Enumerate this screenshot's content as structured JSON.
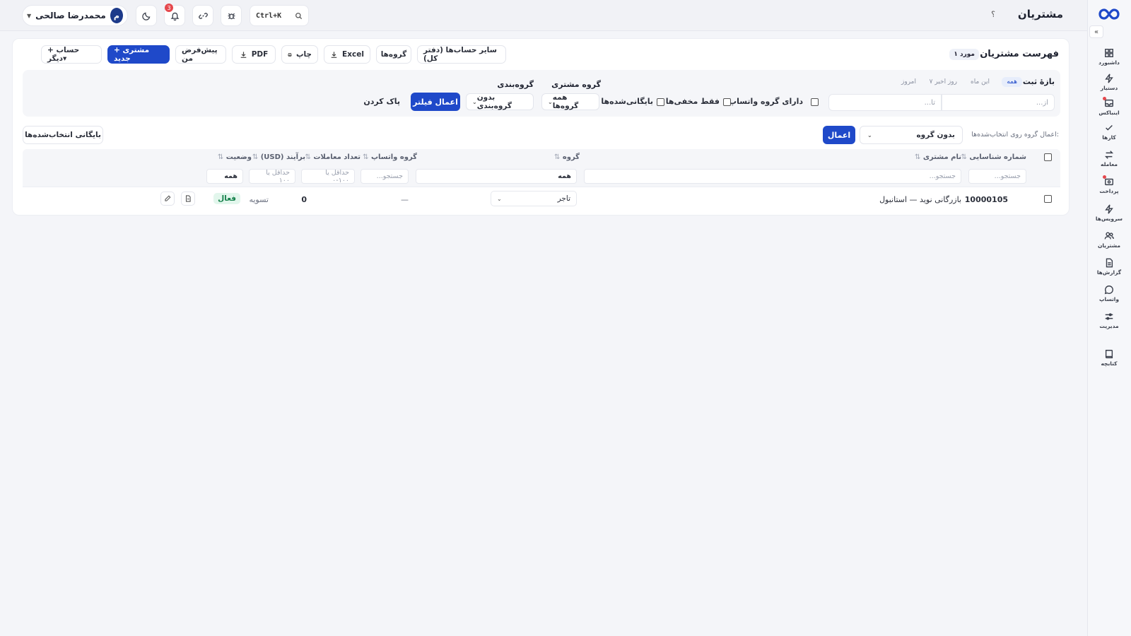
{
  "app": {
    "title": "مشتریان",
    "help": "؟"
  },
  "topbar": {
    "user_name": "محمدرضا صالحی",
    "user_initial": "م",
    "notifications_count": "3",
    "search_shortcut": "Ctrl+K"
  },
  "sidebar": {
    "collapse": "«",
    "items": [
      {
        "label": "داشبورد",
        "icon": "dashboard-icon"
      },
      {
        "label": "دستیار",
        "icon": "bolt-icon"
      },
      {
        "label": "اینباکس",
        "icon": "inbox-icon"
      },
      {
        "label": "کارها",
        "icon": "check-icon"
      },
      {
        "label": "معامله",
        "icon": "swap-icon"
      },
      {
        "label": "پرداخت",
        "icon": "wallet-icon"
      },
      {
        "label": "سرویس‌ها",
        "icon": "bolt-icon"
      },
      {
        "label": "مشتریان",
        "icon": "users-icon"
      },
      {
        "label": "گزارش‌ها",
        "icon": "report-icon"
      },
      {
        "label": "واتساپ",
        "icon": "chat-icon"
      },
      {
        "label": "مدیریت",
        "icon": "sliders-icon"
      },
      {
        "label": "کتابچه",
        "icon": "book-icon"
      }
    ]
  },
  "card": {
    "title": "فهرست مشتریان",
    "count": "۱ مورد"
  },
  "toolbar": {
    "other_accounts": "سایر حساب‌ها (دفتر کل)",
    "groups": "گروه‌ها",
    "excel": "Excel",
    "print": "چاپ",
    "pdf": "PDF",
    "my_default": "پیش‌فرض من",
    "new_customer": "+ مشتری جدید",
    "other_account": "+ حساب دیگر▾"
  },
  "filters": {
    "range_label": "بازهٔ ثبت",
    "ranges": [
      "همه",
      "این ماه",
      "۷ روز اخیر",
      "امروز"
    ],
    "from_placeholder": "از...",
    "to_placeholder": "تا...",
    "has_whatsapp_group": "دارای گروه واتساپ",
    "only_hidden": "فقط مخفی‌ها",
    "archived": "بایگانی‌شده‌ها",
    "customer_group_label": "گروه مشتری",
    "customer_group_value": "همه گروه‌ها",
    "grouping_label": "گروه‌بندی",
    "grouping_value": "بدون گروه‌بندی",
    "apply": "اعمال فیلتر",
    "clear": "پاک کردن"
  },
  "bulk": {
    "label": "اعمال گروه روی انتخاب‌شده‌ها:",
    "select_value": "بدون گروه",
    "apply": "اعمال",
    "archive_selected": "بایگانی انتخاب‌شده‌ها"
  },
  "table": {
    "columns": {
      "id": "شماره شناسایی",
      "name": "نام مشتری",
      "group": "گروه",
      "whatsapp": "گروه واتساپ",
      "deals": "تعداد معاملات",
      "balance": "(USD) برآیند",
      "status": "وضعیت",
      "sort": "⇅"
    },
    "filter_row": {
      "id_ph": "جستجو...",
      "name_ph": "جستجو...",
      "group_val": "همه",
      "whatsapp_ph": "جستجو...",
      "deals_ph": "حداقل یا ۱۰۰-۰",
      "balance_ph": "حداقل یا ۱۰۰",
      "status_val": "همه"
    },
    "rows": [
      {
        "id": "10000105",
        "name": "بازرگانی نوید — استانبول",
        "group": "تاجر",
        "whatsapp": "—",
        "deals": "0",
        "balance": "تسویه",
        "status": "فعال"
      }
    ]
  },
  "colors": {
    "primary": "#1f49c9",
    "status_active_bg": "#e2f6ec",
    "status_active_fg": "#14804a",
    "badge_red": "#e5484d"
  }
}
